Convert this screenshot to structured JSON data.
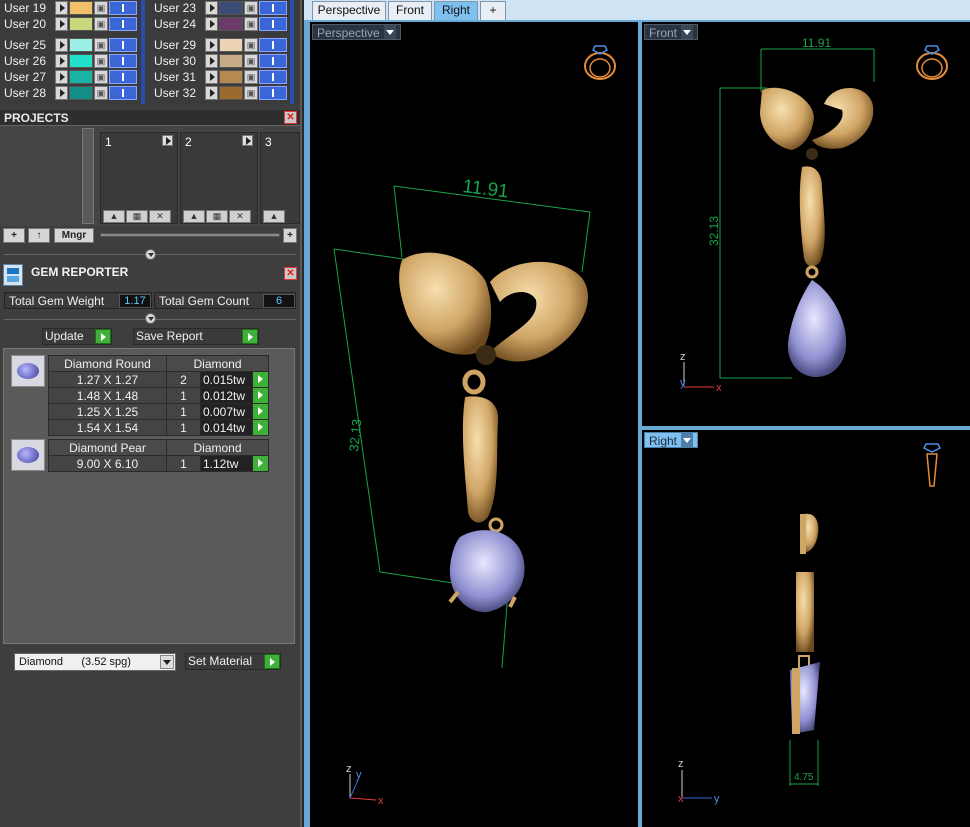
{
  "users": {
    "left": [
      {
        "label": "User 19",
        "color": "#f3c06a"
      },
      {
        "label": "User 20",
        "color": "#c9d87c"
      },
      {
        "label": "User 25",
        "color": "#9cf0e6"
      },
      {
        "label": "User 26",
        "color": "#23e0c8"
      },
      {
        "label": "User 27",
        "color": "#19b4a6"
      },
      {
        "label": "User 28",
        "color": "#138d85"
      }
    ],
    "right": [
      {
        "label": "User 23",
        "color": "#3c4c78"
      },
      {
        "label": "User 24",
        "color": "#6b3a6b"
      },
      {
        "label": "User 29",
        "color": "#ecd3b4"
      },
      {
        "label": "User 30",
        "color": "#c7aa86"
      },
      {
        "label": "User 31",
        "color": "#b58a52"
      },
      {
        "label": "User 32",
        "color": "#9b6a2c"
      }
    ]
  },
  "projects": {
    "title": "PROJECTS",
    "slots": [
      "1",
      "2",
      "3"
    ],
    "toolbar": {
      "add": "+",
      "up": "↑",
      "manager": "Mngr",
      "plus": "+"
    }
  },
  "gem_reporter": {
    "title": "GEM REPORTER",
    "total_weight_label": "Total Gem Weight",
    "total_weight_value": "1.17",
    "total_count_label": "Total Gem Count",
    "total_count_value": "6",
    "update_label": "Update",
    "save_report_label": "Save Report",
    "groups": [
      {
        "shape": "Diamond Round",
        "material": "Diamond",
        "rows": [
          {
            "size": "1.27 X 1.27",
            "qty": "2",
            "weight": "0.015tw"
          },
          {
            "size": "1.48 X 1.48",
            "qty": "1",
            "weight": "0.012tw"
          },
          {
            "size": "1.25 X 1.25",
            "qty": "1",
            "weight": "0.007tw"
          },
          {
            "size": "1.54 X 1.54",
            "qty": "1",
            "weight": "0.014tw"
          }
        ]
      },
      {
        "shape": "Diamond Pear",
        "material": "Diamond",
        "rows": [
          {
            "size": "9.00 X 6.10",
            "qty": "1",
            "weight": "1.12tw"
          }
        ]
      }
    ],
    "material_select": "Diamond      (3.52 spg)",
    "set_material_label": "Set Material"
  },
  "tabs": [
    "Perspective",
    "Front",
    "Right",
    "+"
  ],
  "viewports": {
    "perspective": {
      "label": "Perspective",
      "dim_width": "11.91",
      "dim_height": "32.13"
    },
    "front": {
      "label": "Front",
      "dim_width": "11.91",
      "dim_height": "32.13"
    },
    "right": {
      "label": "Right",
      "dim_width": "4.75"
    }
  },
  "axes": {
    "x": "x",
    "y": "y",
    "z": "z"
  }
}
